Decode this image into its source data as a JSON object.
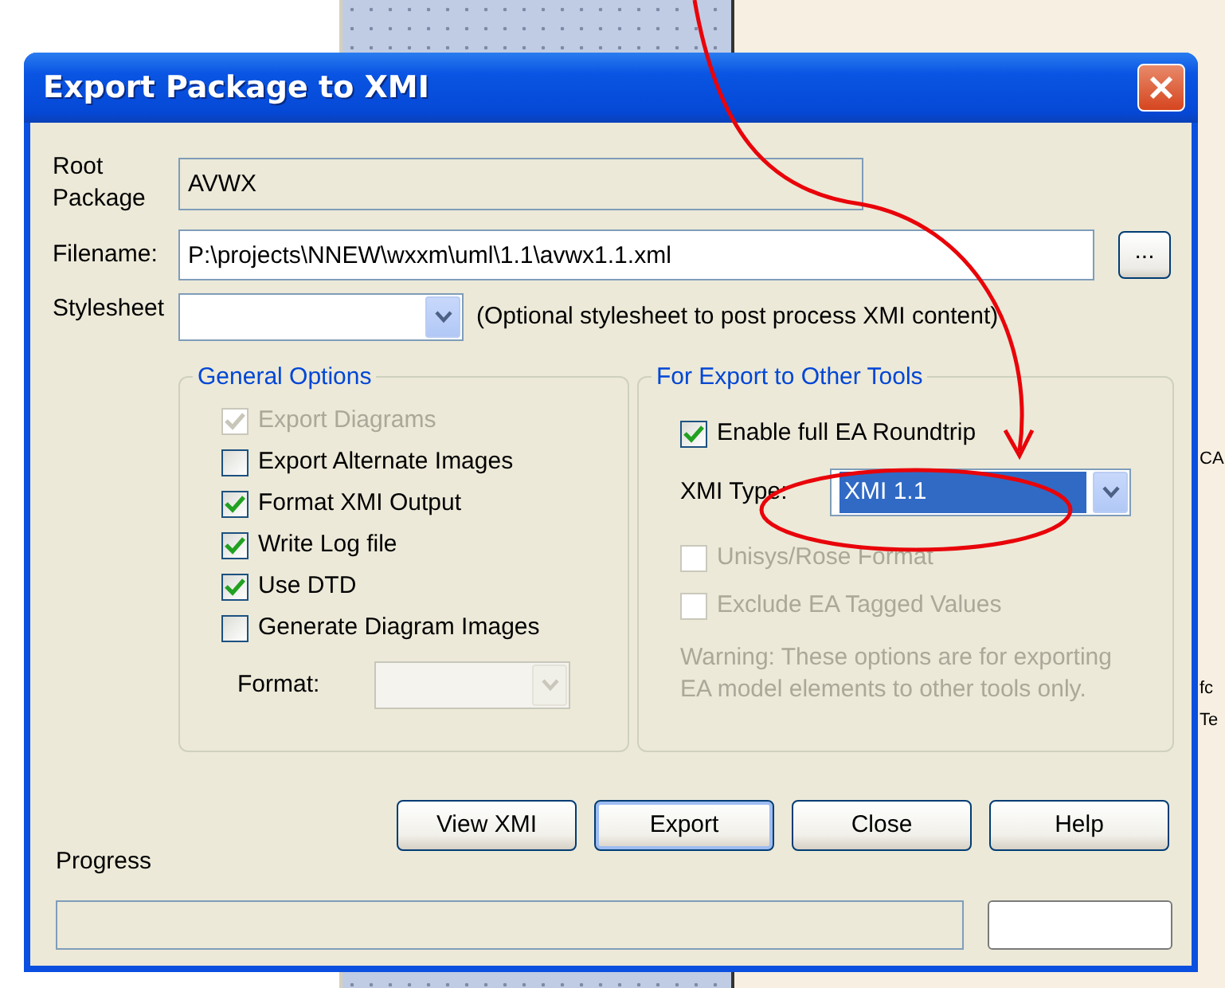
{
  "window": {
    "title": "Export Package to XMI"
  },
  "root_package": {
    "label": "Root Package",
    "value": "AVWX"
  },
  "filename": {
    "label": "Filename:",
    "value": "P:\\projects\\NNEW\\wxxm\\uml\\1.1\\avwx1.1.xml",
    "browse": "..."
  },
  "stylesheet": {
    "label": "Stylesheet",
    "note": "(Optional stylesheet to post process XMI content)"
  },
  "general_options": {
    "title": "General Options",
    "items": [
      {
        "label": "Export Diagrams",
        "checked": true,
        "disabled": true
      },
      {
        "label": "Export Alternate Images",
        "checked": false,
        "disabled": false
      },
      {
        "label": "Format XMI Output",
        "checked": true,
        "disabled": false
      },
      {
        "label": "Write Log file",
        "checked": true,
        "disabled": false
      },
      {
        "label": "Use DTD",
        "checked": true,
        "disabled": false
      },
      {
        "label": "Generate Diagram Images",
        "checked": false,
        "disabled": false
      }
    ],
    "format": {
      "label": "Format:",
      "disabled": true
    }
  },
  "export_other": {
    "title": "For Export to Other Tools",
    "items": [
      {
        "kind": "checkbox",
        "label": "Enable full EA Roundtrip",
        "checked": true,
        "disabled": false
      },
      {
        "kind": "combo",
        "label": "XMI Type:",
        "value": "XMI 1.1"
      },
      {
        "kind": "checkbox",
        "label": "Unisys/Rose Format",
        "checked": false,
        "disabled": true
      },
      {
        "kind": "checkbox",
        "label": "Exclude EA Tagged Values",
        "checked": false,
        "disabled": true
      },
      {
        "kind": "note",
        "label": "Warning: These options are for exporting EA model elements to other tools only."
      }
    ]
  },
  "buttons": [
    {
      "label": "View XMI",
      "focused": false
    },
    {
      "label": "Export",
      "focused": true
    },
    {
      "label": "Close",
      "focused": false
    },
    {
      "label": "Help",
      "focused": false
    }
  ],
  "progress": {
    "label": "Progress"
  },
  "background_fragments": [
    "CA",
    "fc",
    "Te"
  ]
}
